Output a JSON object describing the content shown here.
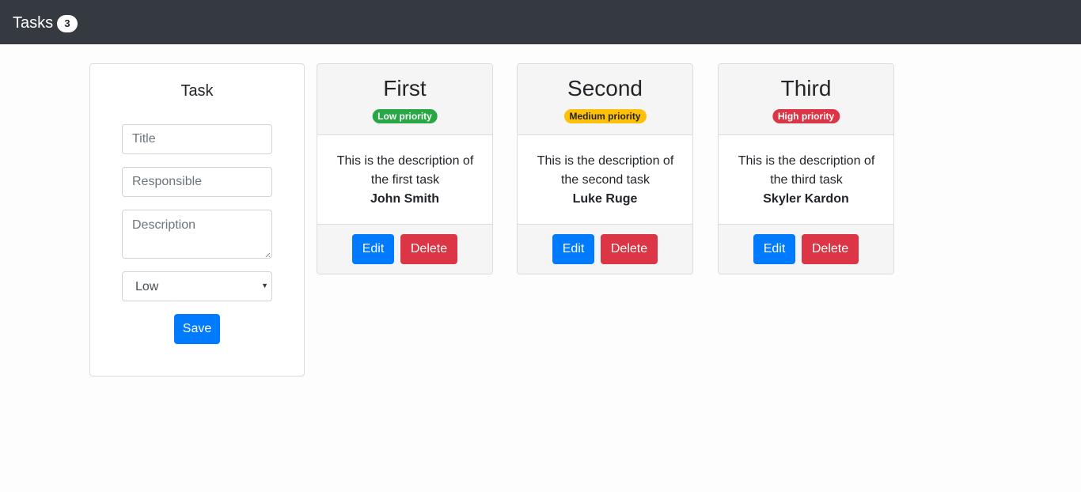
{
  "navbar": {
    "brand": "Tasks",
    "count": "3"
  },
  "form": {
    "title": "Task",
    "title_placeholder": "Title",
    "responsible_placeholder": "Responsible",
    "description_placeholder": "Description",
    "priority_selected": "Low",
    "save_label": "Save"
  },
  "tasks": [
    {
      "title": "First",
      "priority_label": "Low priority",
      "priority_color": "#28a745",
      "description": "This is the description of the first task",
      "responsible": "John Smith",
      "edit_label": "Edit",
      "delete_label": "Delete"
    },
    {
      "title": "Second",
      "priority_label": "Medium priority",
      "priority_color": "#ffc107",
      "description": "This is the description of the second task",
      "responsible": "Luke Ruge",
      "edit_label": "Edit",
      "delete_label": "Delete"
    },
    {
      "title": "Third",
      "priority_label": "High priority",
      "priority_color": "#dc3545",
      "description": "This is the description of the third task",
      "responsible": "Skyler Kardon",
      "edit_label": "Edit",
      "delete_label": "Delete"
    }
  ],
  "colors": {
    "navbar_bg": "#343a40",
    "primary": "#007bff",
    "danger": "#dc3545",
    "success": "#28a745",
    "warning": "#ffc107"
  }
}
